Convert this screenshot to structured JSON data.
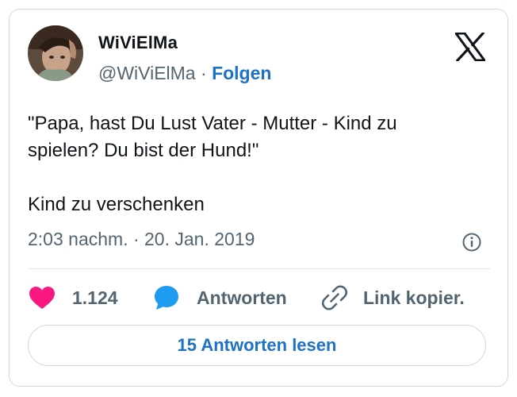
{
  "author": {
    "display_name": "WiViElMa",
    "handle": "@WiViElMa",
    "separator": "·",
    "follow_label": "Folgen"
  },
  "tweet": {
    "text_line1": "\"Papa, hast Du Lust Vater - Mutter - Kind zu spielen? Du bist der Hund!\"",
    "text_line2": "Kind zu verschenken",
    "timestamp": "2:03 nachm. · 20. Jan. 2019"
  },
  "actions": {
    "like_count": "1.124",
    "reply_label": "Antworten",
    "copy_link_label": "Link kopier."
  },
  "read_replies_label": "15 Antworten lesen",
  "icons": {
    "logo": "x-logo-icon",
    "info": "info-icon",
    "like": "heart-icon",
    "reply": "speech-bubble-icon",
    "copy": "link-icon"
  },
  "colors": {
    "accent": "#1d72c4",
    "like": "#f91880",
    "reply": "#1d9bf0",
    "text": "#0f1419",
    "muted": "#536471"
  }
}
